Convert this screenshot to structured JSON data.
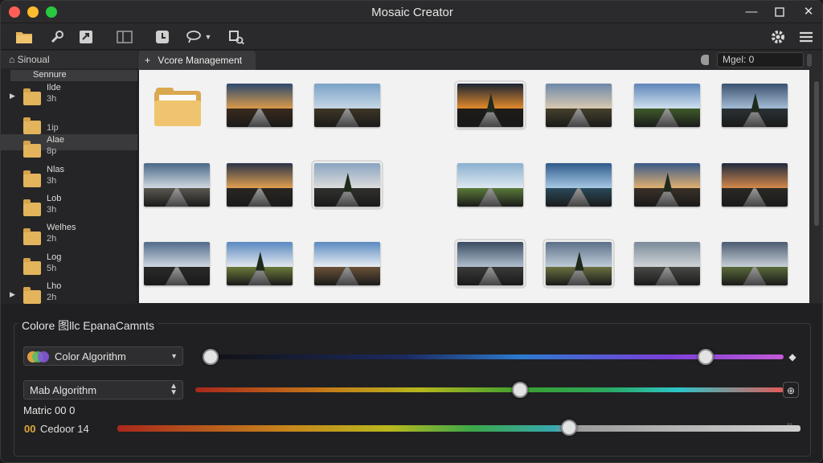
{
  "window": {
    "title": "Mosaic Creator"
  },
  "sidebar": {
    "header": "Sinoual",
    "root": "Sennure",
    "items": [
      {
        "name": "Ilde",
        "sub": "3h",
        "expandable": true,
        "selected": false
      },
      {
        "name": "",
        "sub": "1ip",
        "expandable": false,
        "selected": false
      },
      {
        "name": "Alae",
        "sub": "8p",
        "expandable": false,
        "selected": true
      },
      {
        "name": "Nlas",
        "sub": "3h",
        "expandable": false,
        "selected": false
      },
      {
        "name": "Lob",
        "sub": "3h",
        "expandable": false,
        "selected": false
      },
      {
        "name": "Welhes",
        "sub": "2h",
        "expandable": false,
        "selected": false
      },
      {
        "name": "Log",
        "sub": "5h",
        "expandable": false,
        "selected": false
      },
      {
        "name": "Lho",
        "sub": "2h",
        "expandable": true,
        "selected": false
      }
    ]
  },
  "tabs": {
    "active_label": "Vcore Management",
    "search_value": "Mgel: 0"
  },
  "controls": {
    "group_title": "Colore 图llc EpanaCamnts",
    "color_algorithm": "Color Algorithm",
    "mab_algorithm": "Mab Algorithm",
    "matrix_label": "Matric 00 0",
    "cedoor_prefix": "00",
    "cedoor_label": "Cedoor 14"
  },
  "icons": {
    "toolbar": [
      "folder-open-icon",
      "wrench-icon",
      "export-icon",
      "layout-icon",
      "history-icon",
      "lasso-icon",
      "crop-icon"
    ],
    "toolbar_right": [
      "gear-icon",
      "menu-icon"
    ]
  },
  "slider_levels": {
    "color_min": 0.0,
    "color_max": 0.87,
    "mab": 0.54,
    "cedoor": 0.66
  },
  "colors": {
    "accent_folder": "#e3b45c",
    "grid_bg": "#f2f2f2"
  }
}
